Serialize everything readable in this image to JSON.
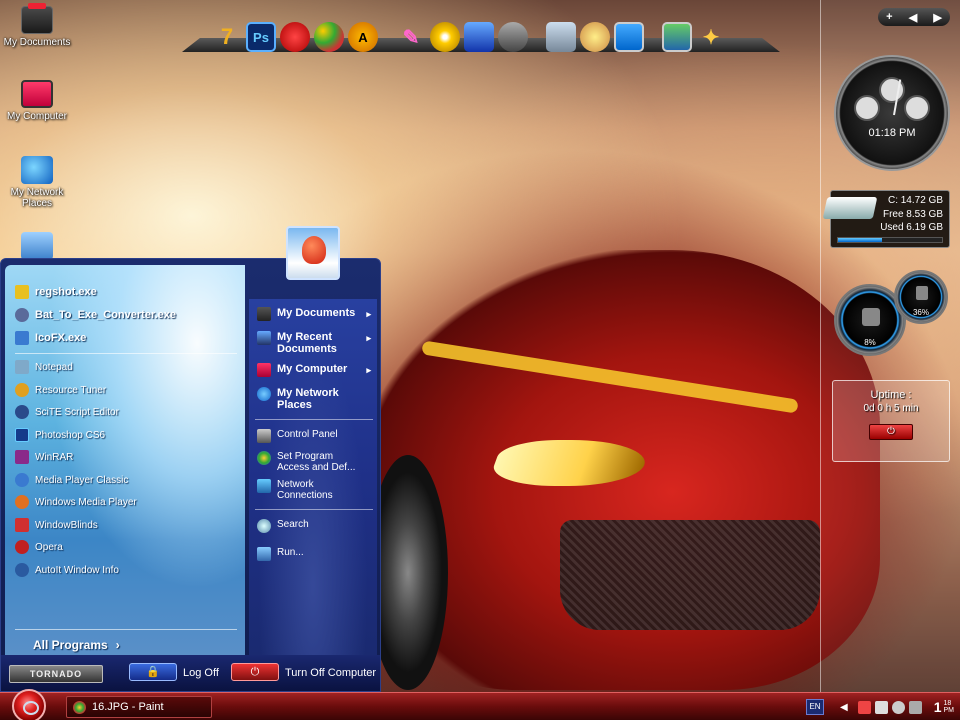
{
  "desktop": {
    "icons": [
      {
        "label": "My Documents"
      },
      {
        "label": "My Computer"
      },
      {
        "label": "My Network Places"
      }
    ]
  },
  "dock": {
    "items": [
      "7-zip-icon",
      "photoshop-icon",
      "ccleaner-icon",
      "paint-icon",
      "aimp-icon",
      "inkscape-icon",
      "dvd-icon",
      "app-store-icon",
      "settings-icon",
      "calculator-icon",
      "brush-icon",
      "monitor-icon",
      "desktop-icon",
      "tools-icon"
    ],
    "ps_label": "Ps"
  },
  "gadgets": {
    "controls": {
      "add": "+",
      "prev": "◀",
      "next": "▶"
    },
    "clock": {
      "time": "01:18 PM"
    },
    "drive": {
      "label": "C:  14.72 GB",
      "free": "Free 8.53 GB",
      "used": "Used 6.19 GB",
      "used_fraction": 0.42
    },
    "cpu_gauge": "8%",
    "mem_gauge": "36%",
    "uptime": {
      "title": "Uptime :",
      "value": "0d 0 h 5 min"
    }
  },
  "start_menu": {
    "pinned": [
      {
        "label": "regshot.exe",
        "color": "#e8c020"
      },
      {
        "label": "Bat_To_Exe_Converter.exe",
        "color": "#5a6a9a"
      },
      {
        "label": "IcoFX.exe",
        "color": "#3a7ad0"
      }
    ],
    "recent": [
      {
        "label": "Notepad",
        "color": "#7fa9c9"
      },
      {
        "label": "Resource Tuner",
        "color": "#e0a020"
      },
      {
        "label": "SciTE Script Editor",
        "color": "#2a4a8a"
      },
      {
        "label": "Photoshop CS6",
        "color": "#143a8a"
      },
      {
        "label": "WinRAR",
        "color": "#8a2a8a"
      },
      {
        "label": "Media Player Classic",
        "color": "#3a7ad0"
      },
      {
        "label": "Windows Media Player",
        "color": "#e07020"
      },
      {
        "label": "WindowBlinds",
        "color": "#d03030"
      },
      {
        "label": "Opera",
        "color": "#c02020"
      },
      {
        "label": "AutoIt Window Info",
        "color": "#2a5aa0"
      }
    ],
    "all_programs": "All Programs",
    "right": [
      {
        "label": "My Documents",
        "bold": true
      },
      {
        "label": "My Recent Documents",
        "bold": true
      },
      {
        "label": "My Computer",
        "bold": true
      },
      {
        "label": "My Network Places",
        "bold": true
      },
      {
        "label": "Control Panel",
        "bold": false
      },
      {
        "label": "Set Program Access and Def...",
        "bold": false
      },
      {
        "label": "Network Connections",
        "bold": false
      },
      {
        "label": "Search",
        "bold": false
      },
      {
        "label": "Run...",
        "bold": false
      }
    ],
    "brand": "TORNADO",
    "log_off": "Log Off",
    "turn_off": "Turn Off Computer"
  },
  "taskbar": {
    "task": "16.JPG - Paint",
    "lang": "EN",
    "clock_hour": "1",
    "clock_min": "18",
    "clock_ampm": "PM"
  }
}
